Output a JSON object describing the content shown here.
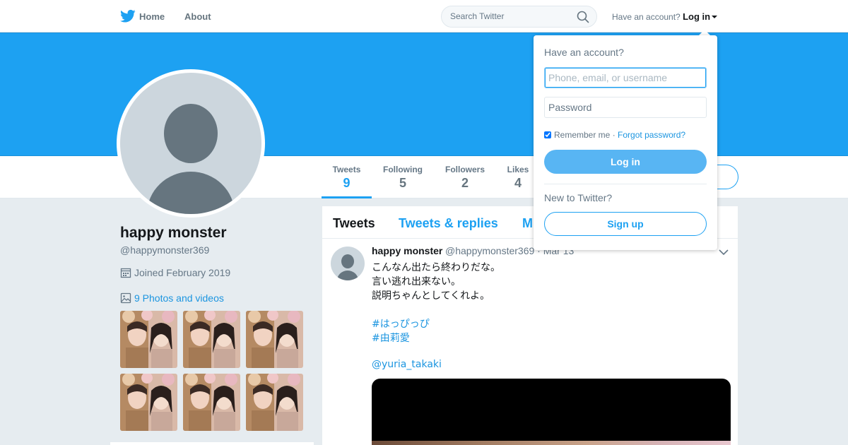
{
  "nav": {
    "home_label": "Home",
    "about_label": "About",
    "search_placeholder": "Search Twitter",
    "have_account": "Have an account?",
    "login_label": "Log in"
  },
  "colors": {
    "brand": "#1da1f2",
    "link": "#1b95e0",
    "background": "#e6ecf0"
  },
  "profile": {
    "name": "happy monster",
    "handle": "@happymonster369",
    "joined": "Joined February 2019",
    "photos_link": "9 Photos and videos",
    "stats": [
      {
        "label": "Tweets",
        "value": "9"
      },
      {
        "label": "Following",
        "value": "5"
      },
      {
        "label": "Followers",
        "value": "2"
      },
      {
        "label": "Likes",
        "value": "4"
      }
    ]
  },
  "timeline": {
    "tabs": [
      "Tweets",
      "Tweets & replies",
      "M"
    ],
    "tweet": {
      "name": "happy monster",
      "handle_date": "@happymonster369 · Mar 13",
      "lines": [
        "こんなん出たら終わりだな。",
        "言い逃れ出来ない。",
        "説明ちゃんとしてくれよ。"
      ],
      "hashtags": [
        "#はっぴっぴ",
        "#由莉愛"
      ],
      "mention": "@yuria_takaki"
    }
  },
  "login_dropdown": {
    "title": "Have an account?",
    "username_placeholder": "Phone, email, or username",
    "password_placeholder": "Password",
    "remember_label": "Remember me",
    "remember_checked": true,
    "separator": "·",
    "forgot_label": "Forgot password?",
    "login_button": "Log in",
    "new_label": "New to Twitter?",
    "signup_button": "Sign up"
  }
}
